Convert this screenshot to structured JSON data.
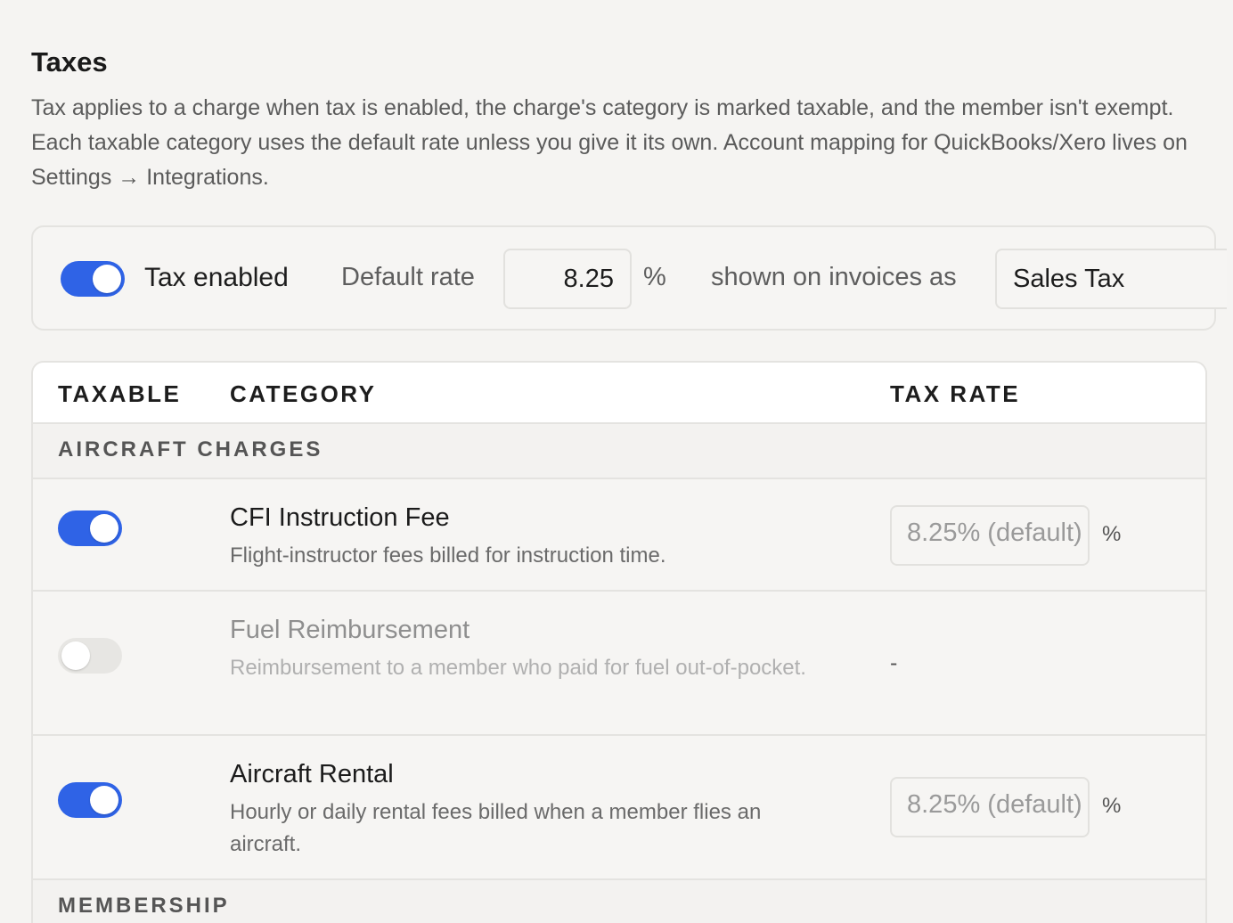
{
  "section": {
    "title": "Taxes",
    "description": "Tax applies to a charge when tax is enabled, the charge's category is marked taxable, and the member isn't exempt. Each taxable category uses the default rate unless you give it its own. Account mapping for QuickBooks/Xero lives on Settings → Integrations."
  },
  "settings": {
    "tax_enabled": true,
    "tax_enabled_label": "Tax enabled",
    "default_rate_label": "Default rate",
    "default_rate_value": "8.25",
    "percent_symbol": "%",
    "shown_as_label": "shown on invoices as",
    "shown_as_value": "Sales Tax"
  },
  "table": {
    "headers": {
      "taxable": "TAXABLE",
      "category": "CATEGORY",
      "tax_rate": "TAX RATE"
    },
    "groups": [
      {
        "label": "AIRCRAFT CHARGES",
        "rows": [
          {
            "taxable": true,
            "name": "CFI Instruction Fee",
            "description": "Flight-instructor fees billed for instruction time.",
            "rate_placeholder": "8.25% (default)",
            "percent": "%"
          },
          {
            "taxable": false,
            "name": "Fuel Reimbursement",
            "description": "Reimbursement to a member who paid for fuel out-of-pocket.",
            "rate_text": "-"
          },
          {
            "taxable": true,
            "name": "Aircraft Rental",
            "description": "Hourly or daily rental fees billed when a member flies an aircraft.",
            "rate_placeholder": "8.25% (default)",
            "percent": "%"
          }
        ]
      },
      {
        "label": "MEMBERSHIP",
        "rows": []
      }
    ]
  },
  "colors": {
    "accent": "#2f63e6",
    "toggle_off": "#e7e6e3",
    "background": "#f5f4f2"
  },
  "icons": {
    "toggle_on": "toggle-switch-on",
    "toggle_off": "toggle-switch-off"
  }
}
